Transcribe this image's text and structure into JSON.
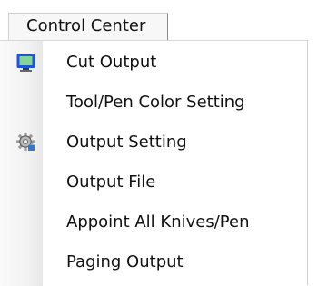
{
  "menu": {
    "title": "Control Center",
    "items": [
      {
        "label": "Cut Output",
        "icon": "monitor-icon"
      },
      {
        "label": "Tool/Pen Color Setting",
        "icon": ""
      },
      {
        "label": "Output Setting",
        "icon": "gear-icon"
      },
      {
        "label": "Output File",
        "icon": ""
      },
      {
        "label": "Appoint All Knives/Pen",
        "icon": ""
      },
      {
        "label": "Paging Output",
        "icon": ""
      }
    ]
  },
  "colors": {
    "menu_bg": "#ffffff",
    "icon_column_bg": "#f1f1f1",
    "border": "#cfcfcf",
    "monitor_blue": "#1f56d6",
    "monitor_green": "#84d49b",
    "gear_gray": "#9a9a9a",
    "gear_dark": "#5d5d5d",
    "accent_blue": "#3c74c9"
  }
}
